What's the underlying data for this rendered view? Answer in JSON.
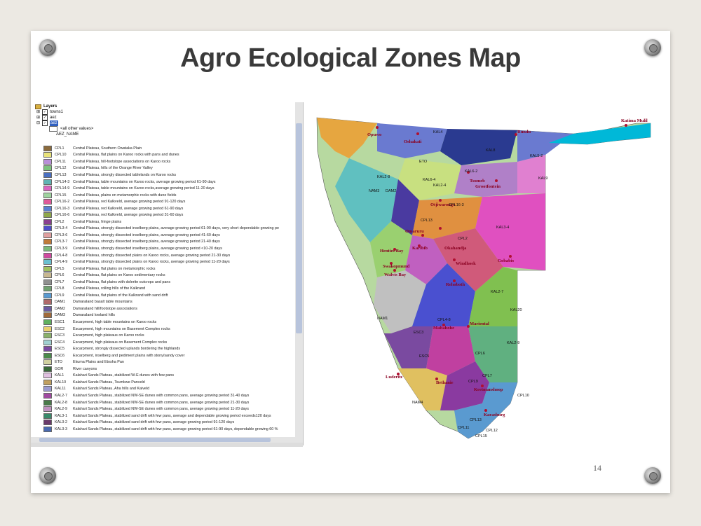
{
  "slide": {
    "title": "Agro Ecological Zones Map",
    "page_number": "14"
  },
  "layers_panel": {
    "header": "Layers",
    "layers": [
      {
        "name": "towns1",
        "checked": true
      },
      {
        "name": "aez",
        "checked": true
      },
      {
        "name": "aez",
        "checked": true
      }
    ],
    "all_other_values": "<all other values>",
    "field_name": "AEZ_NAME",
    "legend": [
      {
        "code": "CPL1",
        "desc": "Central Plateau, Southern Owataka Plain",
        "color": "#8b6b3d"
      },
      {
        "code": "CPL10",
        "desc": "Central Plateau, flat plains on Karoo rocks with pans and dunes",
        "color": "#e8e27a"
      },
      {
        "code": "CPL11",
        "desc": "Central Plateau, hill-footslope associations on Karoo rocks",
        "color": "#b98fd8"
      },
      {
        "code": "CPL12",
        "desc": "Central Plateau, hills of the Orange River Valley",
        "color": "#7cc27c"
      },
      {
        "code": "CPL13",
        "desc": "Central Plateau, strongly dissected tablelands on Karoo rocks",
        "color": "#4a6fc0"
      },
      {
        "code": "CPL14-3",
        "desc": "Central Plateau, table mountains on Karoo rocks, average growing period 61-90 days",
        "color": "#5fb3b3"
      },
      {
        "code": "CPL14-9",
        "desc": "Central Plateau, table mountains on Karoo rocks,average growing period 11-20 days",
        "color": "#d964c0"
      },
      {
        "code": "CPL15",
        "desc": "Central Plateau, plains on metamorphic rocks with dune fields",
        "color": "#9fd39f"
      },
      {
        "code": "CPL16-2",
        "desc": "Central Plateau, red Kalkveld, average growing period 91-120 days",
        "color": "#e05a9a"
      },
      {
        "code": "CPL16-3",
        "desc": "Central Plateau, red Kalkveld, average growing period 61-90 days",
        "color": "#5a7fd0"
      },
      {
        "code": "CPL16-6",
        "desc": "Central Plateau, red Kalkveld, average growing period 31-60 days",
        "color": "#8fa84a"
      },
      {
        "code": "CPL2",
        "desc": "Central Plateau, fringe plains",
        "color": "#8a3f8f"
      },
      {
        "code": "CPL3-4",
        "desc": "Central Plateau, strongly dissected inselberg plains, average growing period 61-90 days, very short dependable growing pe",
        "color": "#4e4ec8"
      },
      {
        "code": "CPL3-6",
        "desc": "Central Plateau, strongly dissected inselberg plains, average growing period 41-60 days",
        "color": "#e0a0a0"
      },
      {
        "code": "CPL3-7",
        "desc": "Central Plateau, strongly dissected inselberg plains, average growing period 21-40 days",
        "color": "#c07a3a"
      },
      {
        "code": "CPL3-9",
        "desc": "Central Plateau, strongly dissected inselberg plains, average growing period <10-20 days",
        "color": "#7ab87a"
      },
      {
        "code": "CPL4-8",
        "desc": "Central Plateau, strongly dissected plains on Karoo rocks, average growing period 21-30 days",
        "color": "#d04aa0"
      },
      {
        "code": "CPL4-9",
        "desc": "Central Plateau, strongly dissected plains on Karoo rocks, average growing period 11-20 days",
        "color": "#6ac0d0"
      },
      {
        "code": "CPL5",
        "desc": "Central Plateau, flat plains on metamorphic rocks",
        "color": "#a0c060"
      },
      {
        "code": "CPL6",
        "desc": "Central Plateau, flat plains on Karoo sedimentary rocks",
        "color": "#c8b890"
      },
      {
        "code": "CPL7",
        "desc": "Central Plateau, flat plains with dolerite outcrops and pans",
        "color": "#909090"
      },
      {
        "code": "CPL8",
        "desc": "Central Plateau, rolling hills of the Kalkrand",
        "color": "#70a070"
      },
      {
        "code": "CPL9",
        "desc": "Central Plateau, flat plains of the Kalkrand with sand drift",
        "color": "#5a9ad0"
      },
      {
        "code": "DAM1",
        "desc": "Damaraland basalt table mountains",
        "color": "#b06a6a"
      },
      {
        "code": "DAM2",
        "desc": "Damaraland hill/footslope associations",
        "color": "#6a5aa0"
      },
      {
        "code": "DAM3",
        "desc": "Damaraland lowland hills",
        "color": "#a06a3a"
      },
      {
        "code": "ESC1",
        "desc": "Escarpment, high table mountains on Karoo rocks",
        "color": "#60b060"
      },
      {
        "code": "ESC2",
        "desc": "Escarpment, high mountains on Basement Complex rocks",
        "color": "#e8d070"
      },
      {
        "code": "ESC3",
        "desc": "Escarpment, high plateaus on Karoo rocks",
        "color": "#8ab06a"
      },
      {
        "code": "ESC4",
        "desc": "Escarpment, high plateaus on Basement Complex rocks",
        "color": "#a0d0d0"
      },
      {
        "code": "ESC5",
        "desc": "Escarpment, strongly dissected uplands bordering the highlands",
        "color": "#7a4aa0"
      },
      {
        "code": "ESC6",
        "desc": "Escarpment, inselberg and pediment plains with stony/sandy cover",
        "color": "#4a8a4a"
      },
      {
        "code": "ETO",
        "desc": "Ekuma Plains and Etosha Pan",
        "color": "#d0d0a0"
      },
      {
        "code": "GOR",
        "desc": "River canyons",
        "color": "#3a6a3a"
      },
      {
        "code": "KAL1",
        "desc": "Kalahari Sands Plateau, stabilized W-E dunes with few pans",
        "color": "#e0c0e0"
      },
      {
        "code": "KAL10",
        "desc": "Kalahari Sands Plateau, Tsumkwe Panveld",
        "color": "#c0a060"
      },
      {
        "code": "KAL11",
        "desc": "Kalahari Sands Plateau, Aha hills and Kaiveld",
        "color": "#9a9ad0"
      },
      {
        "code": "KAL2-7",
        "desc": "Kalahari Sands Plateau, stabilized NW-SE dunes with common pans, average growing period 31-40 days",
        "color": "#a04aa0"
      },
      {
        "code": "KAL2-8",
        "desc": "Kalahari Sands Plateau, stabilized NW-SE dunes with common pans, average growing period 21-30 days",
        "color": "#4a7a4a"
      },
      {
        "code": "KAL2-9",
        "desc": "Kalahari Sands Plateau, stabilized NW-SE dunes with common pans, average growing period 11-20 days",
        "color": "#c090c0"
      },
      {
        "code": "KAL3-1",
        "desc": "Kalahari Sands Plateau, stabilized sand drift with few pans, average and dependable growing period exceeds120 days",
        "color": "#3a8a6a"
      },
      {
        "code": "KAL3-2",
        "desc": "Kalahari Sands Plateau, stabilized sand drift with few pans, average growing period 91-120 days",
        "color": "#6a3a6a"
      },
      {
        "code": "KAL3-3",
        "desc": "Kalahari Sands Plateau, stabilized sand drift with few pans, average growing period 61-90 days, dependable growing 60 %",
        "color": "#4a6ab0"
      }
    ]
  },
  "map": {
    "towns": [
      "Katima Mulil",
      "Rundu",
      "Opuwo",
      "Oshakati",
      "Tsumeb",
      "Grootfontein",
      "Otjiwarongo",
      "Omaruru",
      "Okahandja",
      "Henties Bay",
      "Karibib",
      "Swakopmund",
      "Walvis Bay",
      "Windhoek",
      "Gobabis",
      "Rehoboth",
      "Mariental",
      "Maltahohe",
      "Luderitz",
      "Bethanie",
      "Keetmanshoop",
      "Karasburg"
    ],
    "zone_labels": [
      "KAL3-4",
      "KAL4",
      "KAL8",
      "KAL5-2",
      "KAL9",
      "ETO",
      "KAL6-2",
      "KAL6-4",
      "KAL2-8",
      "CPL16-3",
      "CPL10",
      "CPL12",
      "CPL13",
      "CPL2",
      "KAL2-4",
      "KAL2-7",
      "KAL2-9",
      "KAL20",
      "NAM3",
      "NAM1",
      "ESC3",
      "ESC5",
      "CPL4-8",
      "CPL6",
      "CPL9",
      "CPL7",
      "CPL13",
      "CPL11",
      "CPL15",
      "NAM4",
      "DAM2"
    ]
  }
}
